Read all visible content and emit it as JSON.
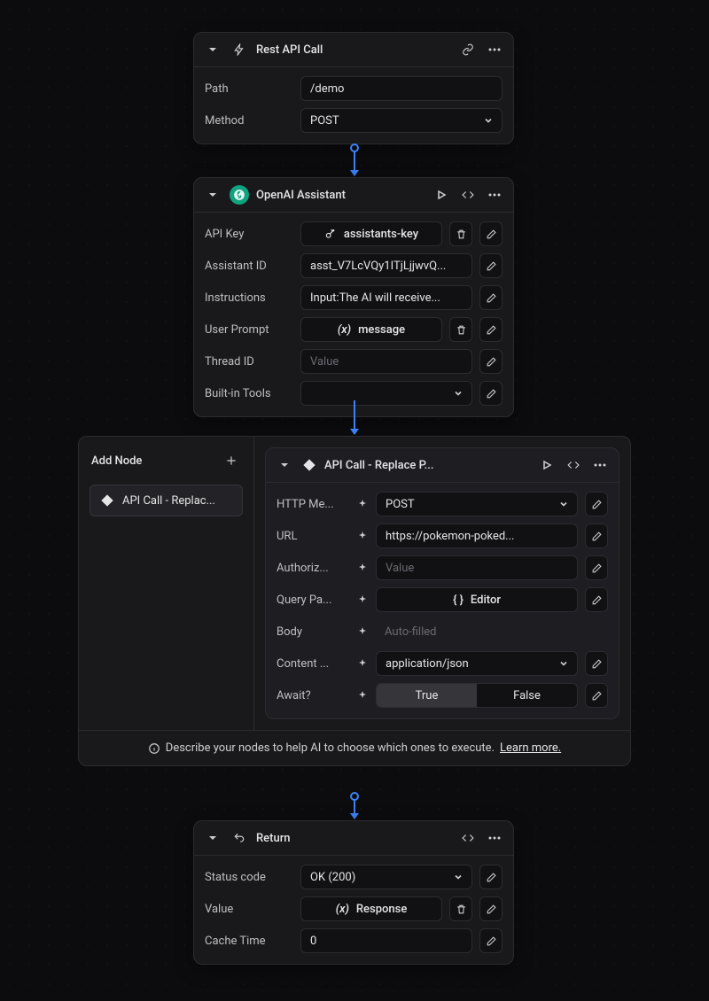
{
  "nodes": {
    "rest": {
      "title": "Rest API Call",
      "path_label": "Path",
      "path_value": "/demo",
      "method_label": "Method",
      "method_value": "POST"
    },
    "assistant": {
      "title": "OpenAI Assistant",
      "api_key_label": "API Key",
      "api_key_value": "assistants-key",
      "assistant_id_label": "Assistant ID",
      "assistant_id_value": "asst_V7LcVQy1ITjLjjwvQ...",
      "instructions_label": "Instructions",
      "instructions_value": "Input:The AI will receive...",
      "user_prompt_label": "User Prompt",
      "user_prompt_value": "message",
      "thread_id_label": "Thread ID",
      "thread_id_placeholder": "Value",
      "tools_label": "Built-in Tools"
    },
    "addnode": {
      "header": "Add Node",
      "item_label": "API Call - Replac...",
      "info_text": "Describe your nodes to help AI to choose which ones to execute.",
      "info_link": "Learn more."
    },
    "apicall": {
      "title": "API Call - Replace P...",
      "method_label": "HTTP Me...",
      "method_value": "POST",
      "url_label": "URL",
      "url_value": "https://pokemon-poked...",
      "auth_label": "Authoriz...",
      "auth_placeholder": "Value",
      "query_label": "Query Pa...",
      "query_value": "Editor",
      "body_label": "Body",
      "body_placeholder": "Auto-filled",
      "content_label": "Content ...",
      "content_value": "application/json",
      "await_label": "Await?",
      "await_true": "True",
      "await_false": "False"
    },
    "ret": {
      "title": "Return",
      "status_label": "Status code",
      "status_value": "OK (200)",
      "value_label": "Value",
      "value_value": "Response",
      "cache_label": "Cache Time",
      "cache_value": "0"
    }
  }
}
